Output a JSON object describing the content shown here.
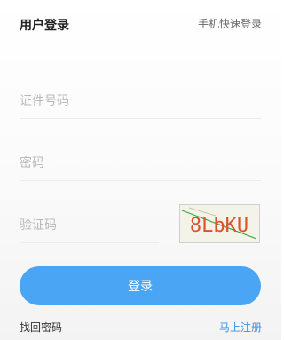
{
  "header": {
    "title": "用户登录",
    "quick_login_link": "手机快速登录"
  },
  "form": {
    "id_number_placeholder": "证件号码",
    "password_placeholder": "密码",
    "captcha_placeholder": "验证码",
    "captcha_text": "8LbKU"
  },
  "actions": {
    "login_label": "登录",
    "forgot_password": "找回密码",
    "register": "马上注册"
  },
  "colors": {
    "primary": "#4aa5f5",
    "link": "#3d8fe0",
    "captcha_text": "#e0502a",
    "captcha_line": "#3aa63a"
  }
}
